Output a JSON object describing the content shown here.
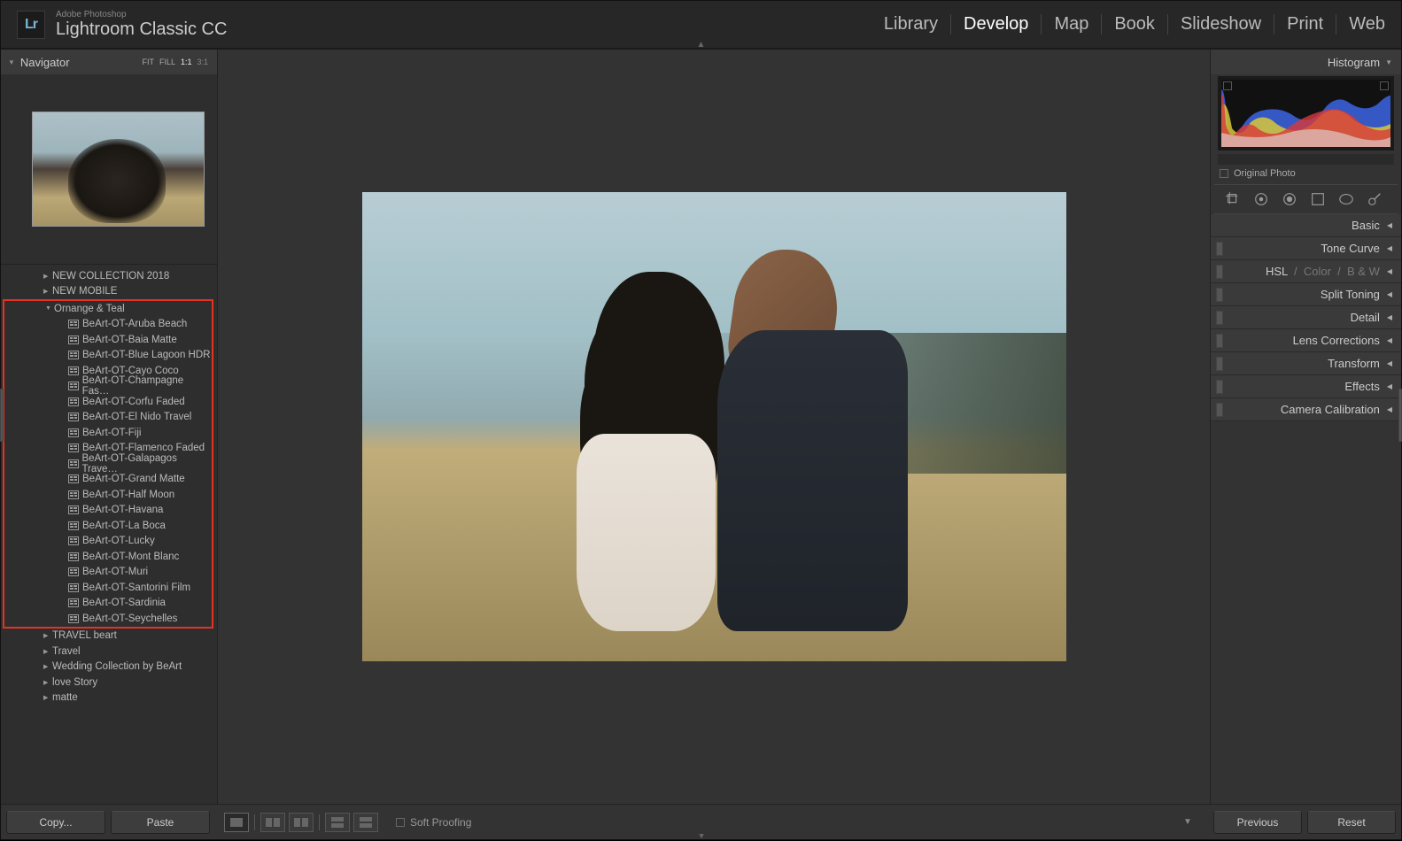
{
  "app": {
    "brand_sub": "Adobe Photoshop",
    "brand_main": "Lightroom Classic CC",
    "logo_mark": "Lr"
  },
  "modules": [
    "Library",
    "Develop",
    "Map",
    "Book",
    "Slideshow",
    "Print",
    "Web"
  ],
  "active_module": "Develop",
  "navigator": {
    "title": "Navigator",
    "zoom": [
      "FIT",
      "FILL",
      "1:1",
      "3:1"
    ]
  },
  "collections_top": [
    {
      "label": "NEW COLLECTION 2018",
      "expanded": false
    },
    {
      "label": "NEW MOBILE",
      "expanded": false
    }
  ],
  "highlighted_folder": {
    "label": "Ornange & Teal",
    "presets": [
      "BeArt-OT-Aruba Beach",
      "BeArt-OT-Baia Matte",
      "BeArt-OT-Blue Lagoon HDR",
      "BeArt-OT-Cayo Coco",
      "BeArt-OT-Champagne Fas…",
      "BeArt-OT-Corfu Faded",
      "BeArt-OT-El Nido Travel",
      "BeArt-OT-Fiji",
      "BeArt-OT-Flamenco Faded",
      "BeArt-OT-Galapagos Trave…",
      "BeArt-OT-Grand Matte",
      "BeArt-OT-Half Moon",
      "BeArt-OT-Havana",
      "BeArt-OT-La Boca",
      "BeArt-OT-Lucky",
      "BeArt-OT-Mont Blanc",
      "BeArt-OT-Muri",
      "BeArt-OT-Santorini Film",
      "BeArt-OT-Sardinia",
      "BeArt-OT-Seychelles"
    ]
  },
  "collections_bottom": [
    "TRAVEL beart",
    "Travel",
    "Wedding Collection by BeArt",
    "love Story",
    "matte"
  ],
  "histogram": {
    "title": "Histogram",
    "original_label": "Original Photo"
  },
  "right_panels": [
    {
      "label": "Basic"
    },
    {
      "label_html": "HSL  /  Color  /  B & W",
      "prefix": "Tone Curve"
    },
    {
      "label": "Tone Curve"
    },
    {
      "label": "HSL",
      "group": true
    },
    {
      "label": "Split Toning"
    },
    {
      "label": "Detail"
    },
    {
      "label": "Lens Corrections"
    },
    {
      "label": "Transform"
    },
    {
      "label": "Effects"
    },
    {
      "label": "Camera Calibration"
    }
  ],
  "footer": {
    "copy": "Copy...",
    "paste": "Paste",
    "softproof": "Soft Proofing",
    "previous": "Previous",
    "reset": "Reset"
  }
}
